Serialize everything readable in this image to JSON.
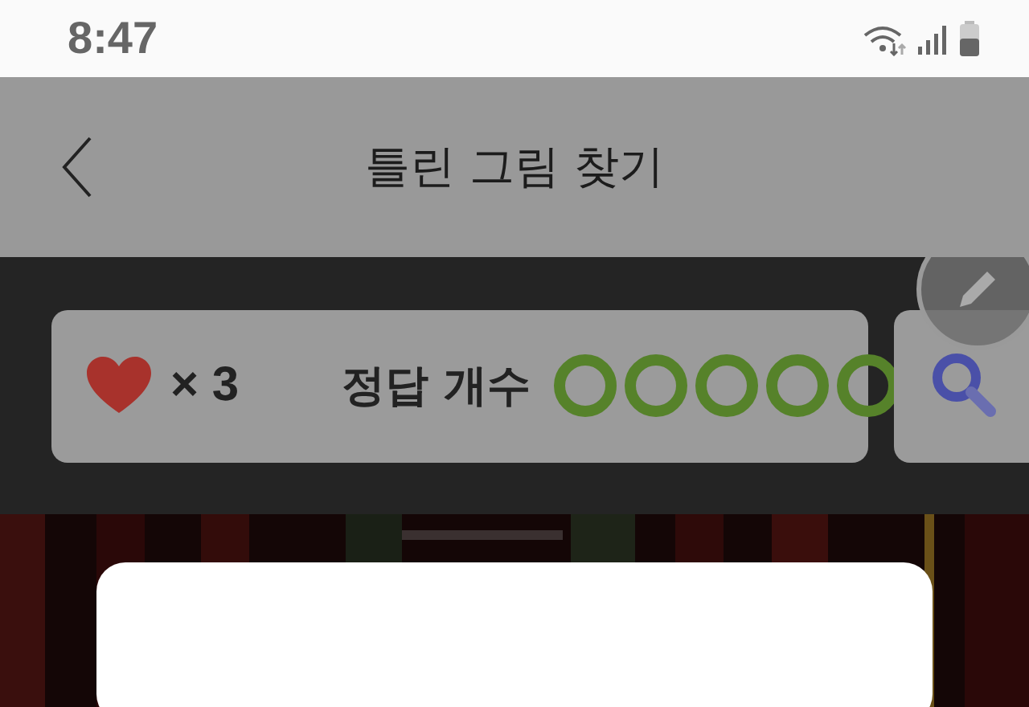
{
  "status_bar": {
    "time": "8:47"
  },
  "header": {
    "title": "틀린 그림 찾기"
  },
  "score_card": {
    "lives": "× 3",
    "answers_label": "정답 개수"
  }
}
